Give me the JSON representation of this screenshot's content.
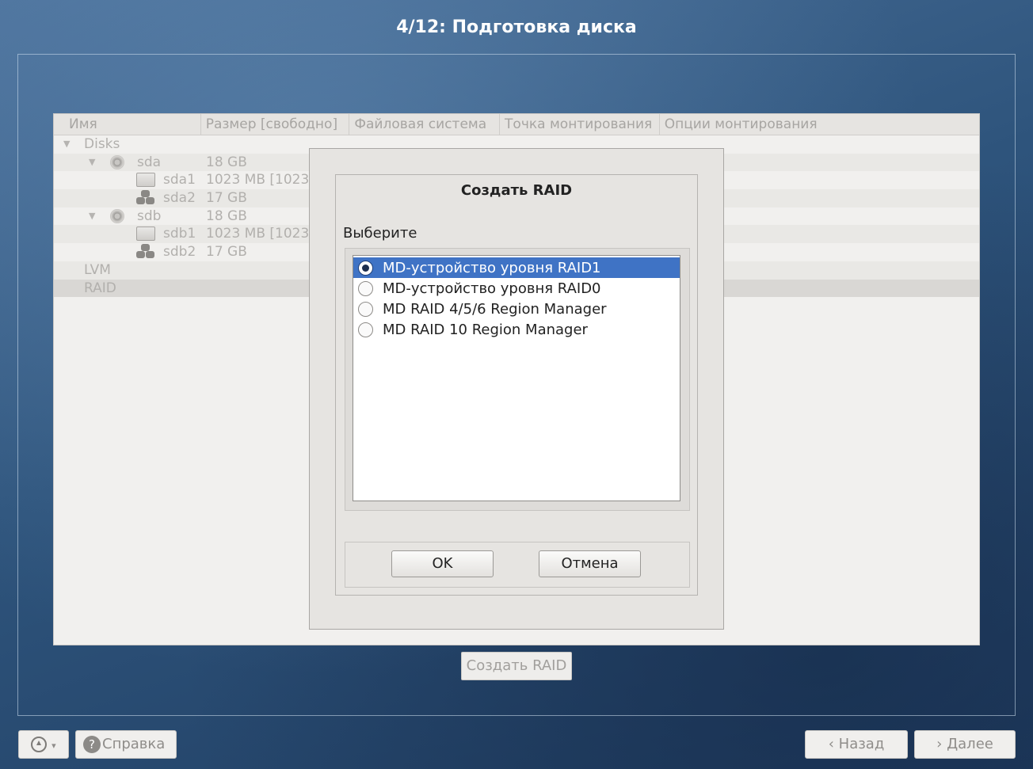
{
  "window": {
    "title": "4/12: Подготовка диска"
  },
  "tree": {
    "columns": [
      "Имя",
      "Размер [свободно]",
      "Файловая система",
      "Точка монтирования",
      "Опции монтирования"
    ],
    "rows": [
      {
        "name": "Disks",
        "size": "",
        "icon": "triangle-down-icon"
      },
      {
        "name": "sda",
        "size": "18 GB",
        "icon": "disk-icon"
      },
      {
        "name": "sda1",
        "size": "1023 MB [1023",
        "icon": "partition-icon"
      },
      {
        "name": "sda2",
        "size": "17 GB",
        "icon": "lvm-volume-icon"
      },
      {
        "name": "sdb",
        "size": "18 GB",
        "icon": "disk-icon"
      },
      {
        "name": "sdb1",
        "size": "1023 MB [1023",
        "icon": "partition-icon"
      },
      {
        "name": "sdb2",
        "size": "17 GB",
        "icon": "lvm-volume-icon"
      },
      {
        "name": "LVM",
        "size": "",
        "icon": ""
      },
      {
        "name": "RAID",
        "size": "",
        "icon": ""
      }
    ]
  },
  "dialog": {
    "title": "Создать RAID",
    "prompt": "Выберите",
    "options": [
      {
        "label": "MD-устройство уровня RAID1",
        "selected": true
      },
      {
        "label": "MD-устройство уровня RAID0",
        "selected": false
      },
      {
        "label": "MD RAID 4/5/6 Region Manager",
        "selected": false
      },
      {
        "label": "MD RAID 10 Region Manager",
        "selected": false
      }
    ],
    "ok_label": "OK",
    "cancel_label": "Отмена"
  },
  "create_raid_button": "Создать RAID",
  "footer": {
    "help_label": "Справка",
    "back_label": "Назад",
    "next_label": "Далее"
  },
  "colors": {
    "selection": "#3f73c5",
    "background": "#2c5178"
  }
}
